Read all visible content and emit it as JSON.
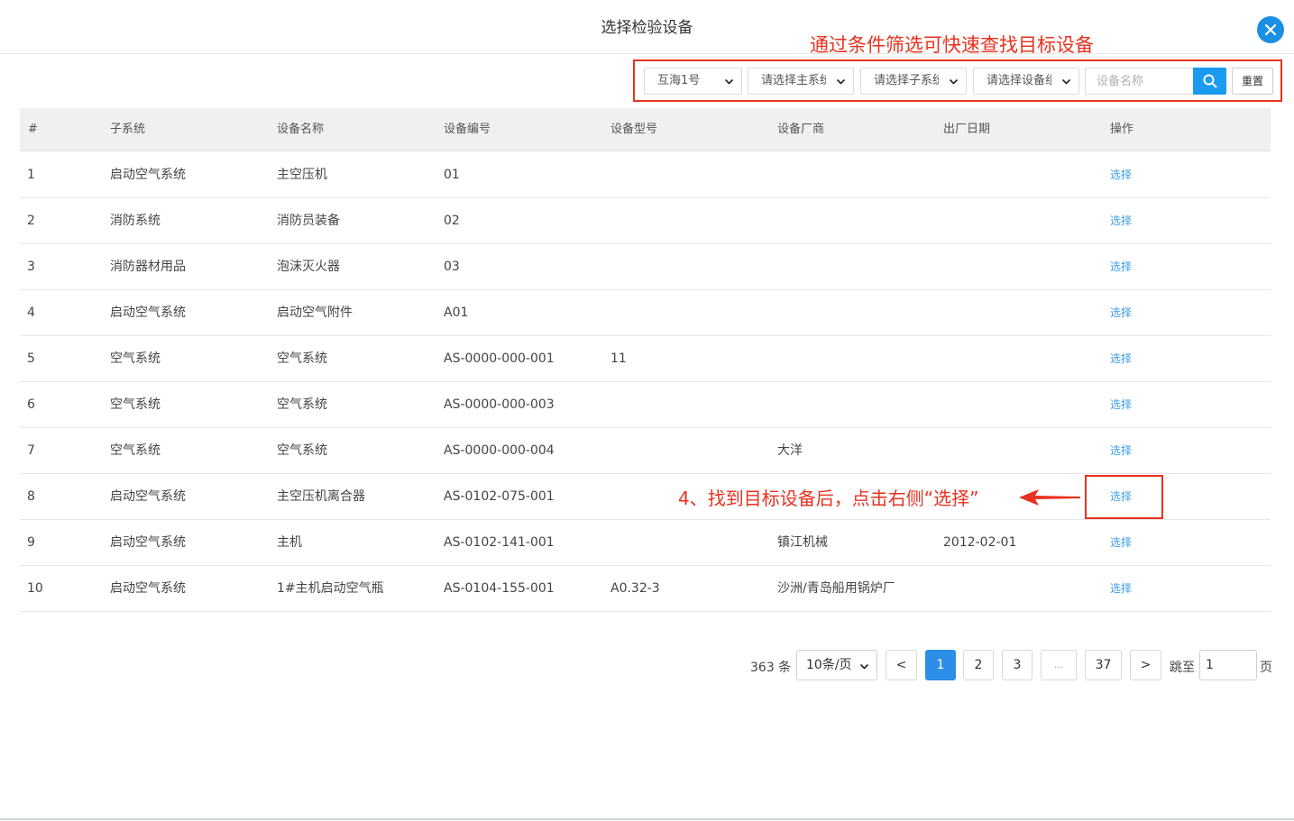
{
  "modal": {
    "title": "选择检验设备"
  },
  "annotations": {
    "filter_hint": "通过条件筛选可快速查找目标设备",
    "step_hint": "4、找到目标设备后，点击右侧“选择”"
  },
  "filters": {
    "ship": "互海1号",
    "main_system": "请选择主系统",
    "sub_system": "请选择子系统",
    "equipment_group": "请选择设备组",
    "name_placeholder": "设备名称",
    "reset_label": "重置"
  },
  "table": {
    "headers": [
      "#",
      "子系统",
      "设备名称",
      "设备编号",
      "设备型号",
      "设备厂商",
      "出厂日期",
      "操作"
    ],
    "rows": [
      {
        "no": "1",
        "subsystem": "启动空气系统",
        "name": "主空压机",
        "code": "01",
        "model": "",
        "maker": "",
        "date": "",
        "action": "选择"
      },
      {
        "no": "2",
        "subsystem": "消防系统",
        "name": "消防员装备",
        "code": "02",
        "model": "",
        "maker": "",
        "date": "",
        "action": "选择"
      },
      {
        "no": "3",
        "subsystem": "消防器材用品",
        "name": "泡沫灭火器",
        "code": "03",
        "model": "",
        "maker": "",
        "date": "",
        "action": "选择"
      },
      {
        "no": "4",
        "subsystem": "启动空气系统",
        "name": "启动空气附件",
        "code": "A01",
        "model": "",
        "maker": "",
        "date": "",
        "action": "选择"
      },
      {
        "no": "5",
        "subsystem": "空气系统",
        "name": "空气系统",
        "code": "AS-0000-000-001",
        "model": "11",
        "maker": "",
        "date": "",
        "action": "选择"
      },
      {
        "no": "6",
        "subsystem": "空气系统",
        "name": "空气系统",
        "code": "AS-0000-000-003",
        "model": "",
        "maker": "",
        "date": "",
        "action": "选择"
      },
      {
        "no": "7",
        "subsystem": "空气系统",
        "name": "空气系统",
        "code": "AS-0000-000-004",
        "model": "",
        "maker": "大洋",
        "date": "",
        "action": "选择"
      },
      {
        "no": "8",
        "subsystem": "启动空气系统",
        "name": "主空压机离合器",
        "code": "AS-0102-075-001",
        "model": "",
        "maker": "",
        "date": "",
        "action": "选择"
      },
      {
        "no": "9",
        "subsystem": "启动空气系统",
        "name": "主机",
        "code": "AS-0102-141-001",
        "model": "",
        "maker": "镇江机械",
        "date": "2012-02-01",
        "action": "选择"
      },
      {
        "no": "10",
        "subsystem": "启动空气系统",
        "name": "1#主机启动空气瓶",
        "code": "AS-0104-155-001",
        "model": "A0.32-3",
        "maker": "沙洲/青岛船用锅炉厂",
        "date": "",
        "action": "选择"
      }
    ]
  },
  "pagination": {
    "total": "363 条",
    "page_size": "10条/页",
    "prev": "<",
    "next": ">",
    "pages": [
      "1",
      "2",
      "3",
      "...",
      "37"
    ],
    "current": "1",
    "jump_label": "跳至",
    "jump_value": "1",
    "jump_unit": "页"
  },
  "colors": {
    "accent": "#1a9bf0",
    "annotation": "#e8321f",
    "link": "#3b9de8"
  }
}
